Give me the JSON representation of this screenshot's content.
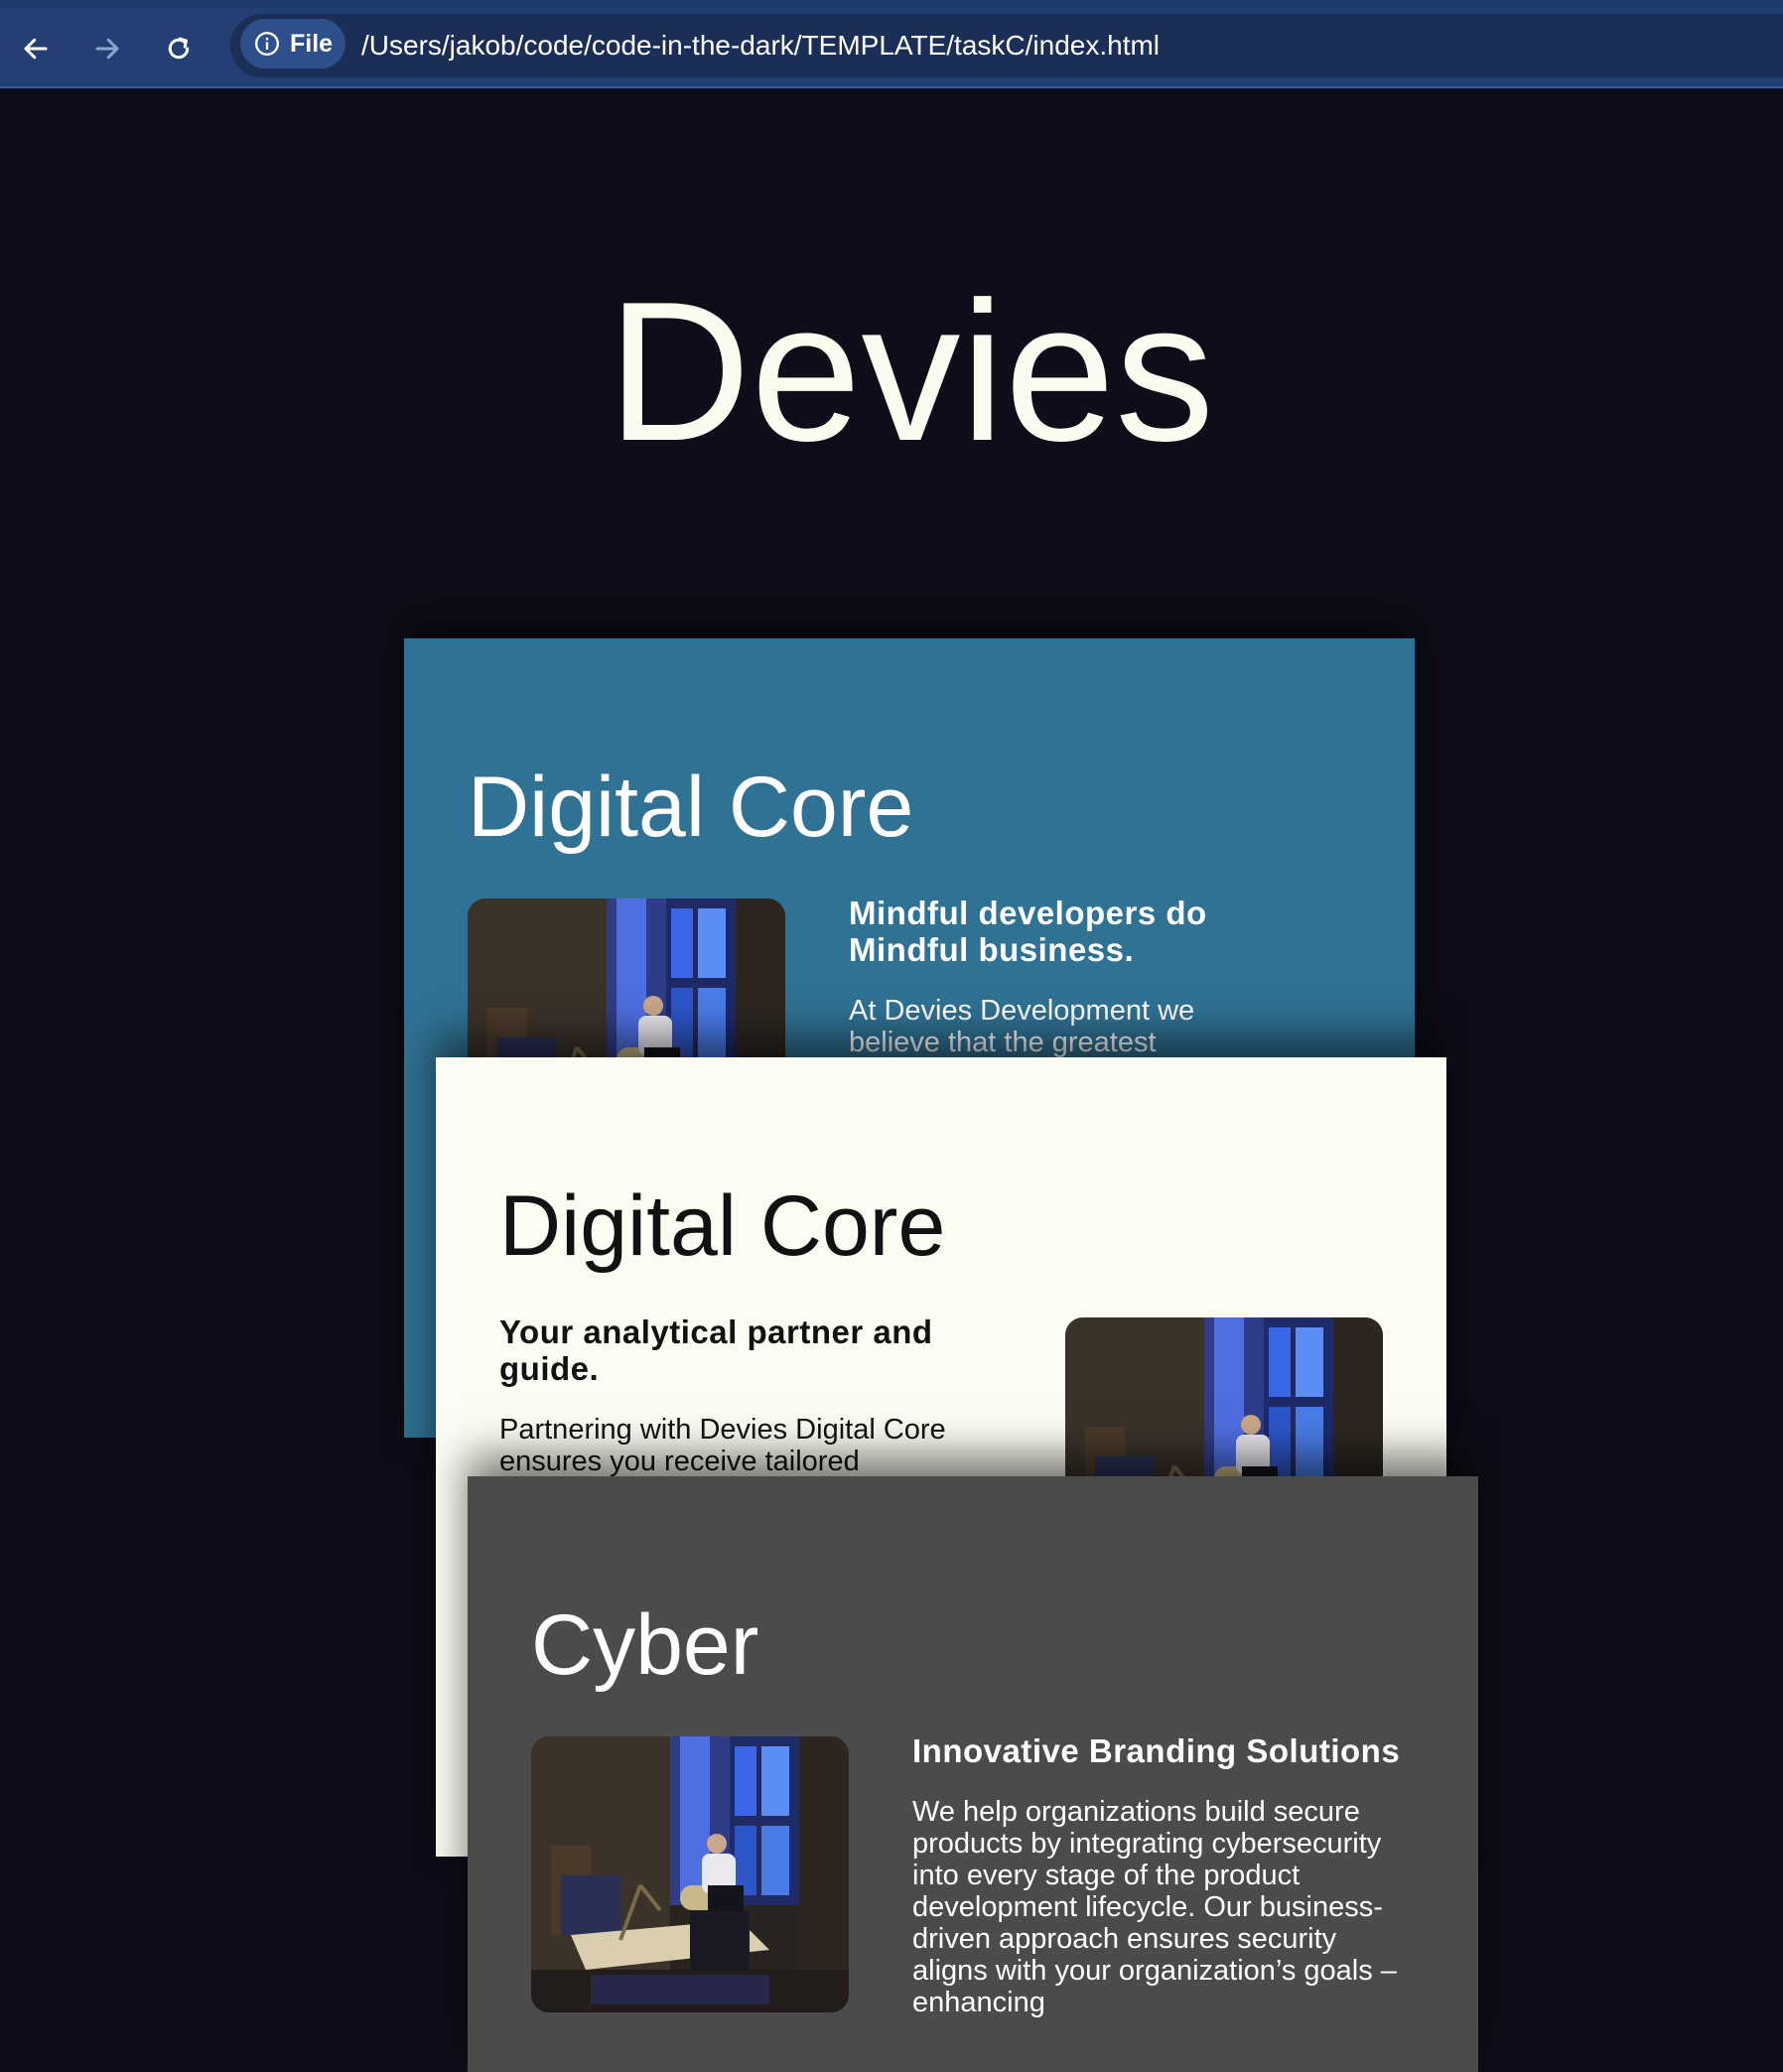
{
  "browser": {
    "back_icon": "arrow-left-icon",
    "forward_icon": "arrow-right-icon",
    "reload_icon": "reload-icon",
    "site_info_icon": "info-icon",
    "site_chip_label": "File",
    "url": "/Users/jakob/code/code-in-the-dark/TEMPLATE/taskC/index.html"
  },
  "page": {
    "title": "Devies"
  },
  "cards": [
    {
      "title": "Digital Core",
      "heading": "Mindful developers do Mindful business.",
      "body": "At Devies Development we believe that the greatest values are",
      "image_icon": "developer-at-desk-photo",
      "background": "#307294"
    },
    {
      "title": "Digital Core",
      "heading": "Your analytical partner and guide.",
      "body": "Partnering with Devies Digital Core ensures you receive tailored",
      "image_icon": "developer-at-desk-photo",
      "background": "#fcfcf3"
    },
    {
      "title": "Cyber",
      "heading": "Innovative Branding Solutions",
      "body": "We help organizations build secure products by integrating cybersecurity into every stage of the product development lifecycle. Our business-driven approach ensures security aligns with your organization’s goals – enhancing",
      "image_icon": "developer-at-desk-photo",
      "background": "#4b4b4b"
    }
  ]
}
